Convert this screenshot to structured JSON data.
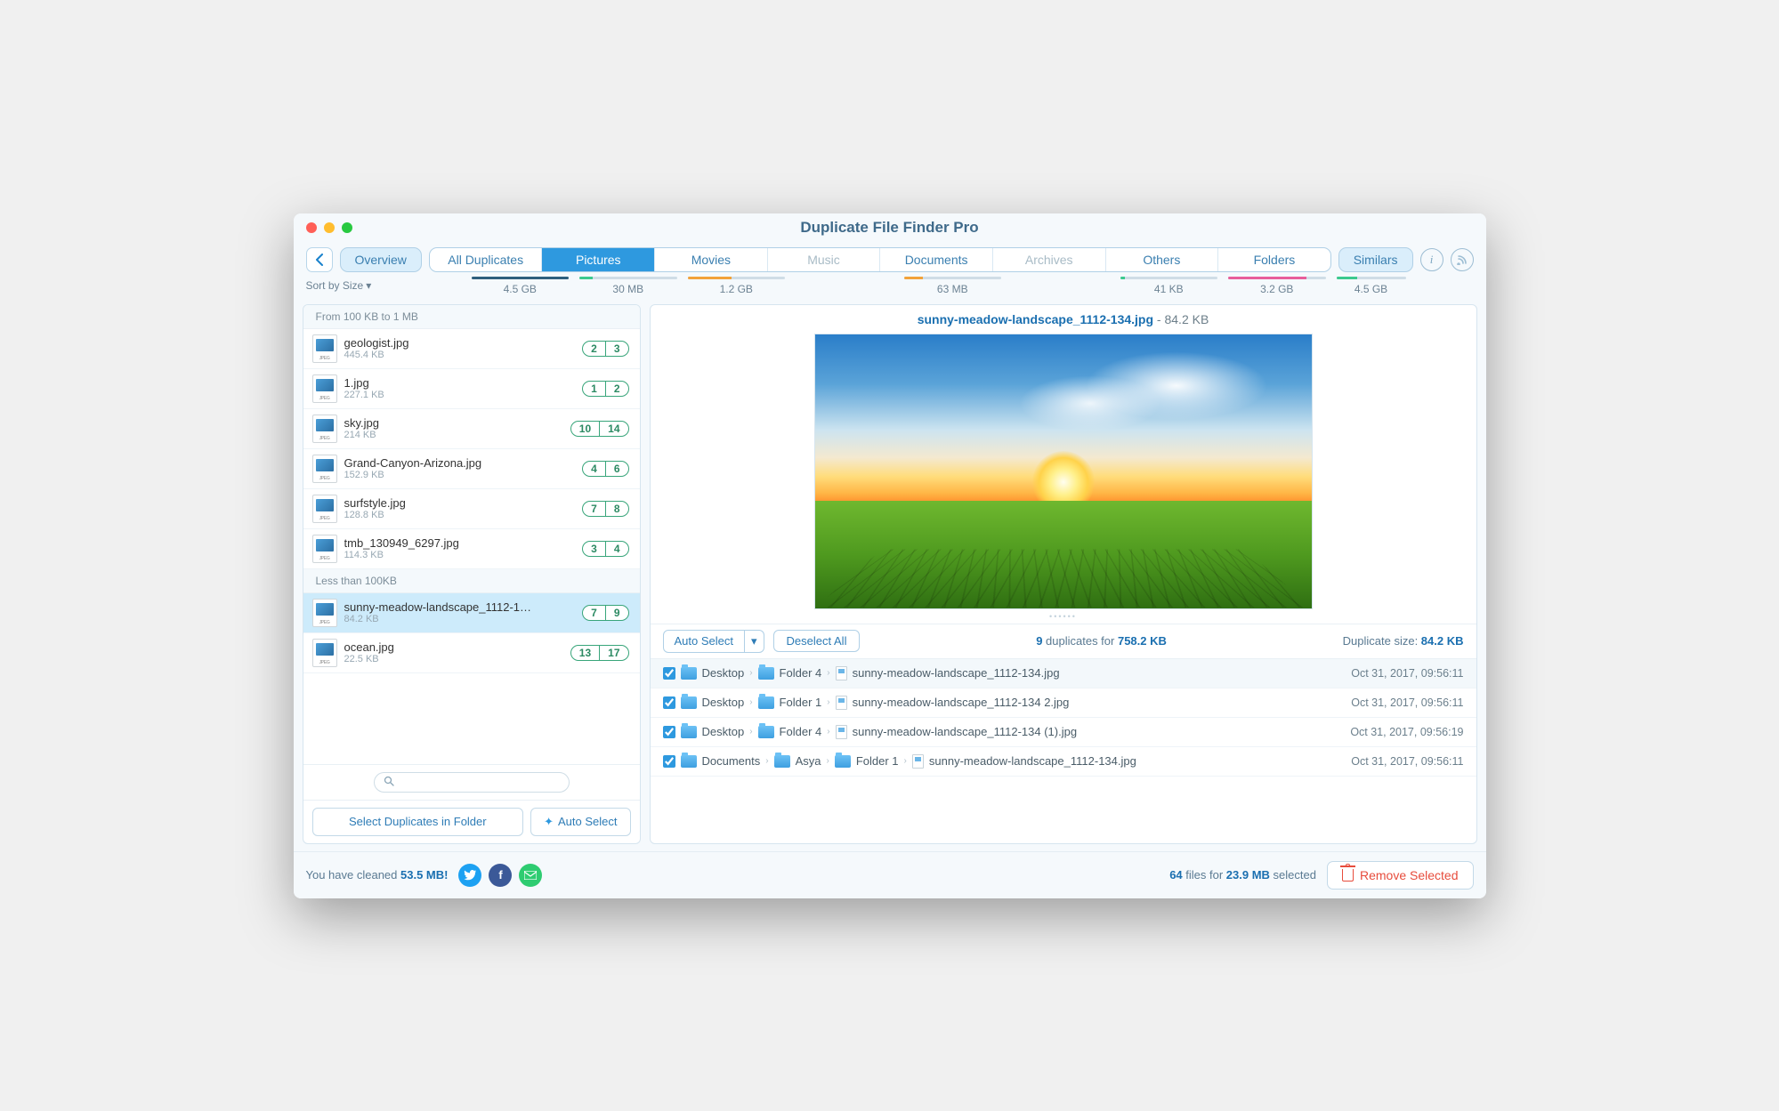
{
  "title": "Duplicate File Finder Pro",
  "sort_label": "Sort by Size",
  "tabs": [
    {
      "label": "Overview",
      "active": false,
      "disabled": false
    },
    {
      "label": "All Duplicates",
      "size": "4.5 GB",
      "bar_color": "#2f5f7d",
      "bar_pct": 100
    },
    {
      "label": "Pictures",
      "size": "30 MB",
      "bar_color": "#3cc98e",
      "bar_pct": 14,
      "active": true
    },
    {
      "label": "Movies",
      "size": "1.2 GB",
      "bar_color": "#f2a23a",
      "bar_pct": 45
    },
    {
      "label": "Music",
      "size": "",
      "disabled": true
    },
    {
      "label": "Documents",
      "size": "63 MB",
      "bar_color": "#f2a23a",
      "bar_pct": 20
    },
    {
      "label": "Archives",
      "size": "",
      "disabled": true
    },
    {
      "label": "Others",
      "size": "41 KB",
      "bar_color": "#3cc98e",
      "bar_pct": 5
    },
    {
      "label": "Folders",
      "size": "3.2 GB",
      "bar_color": "#e85e9a",
      "bar_pct": 80
    }
  ],
  "similars": {
    "label": "Similars",
    "size": "4.5 GB",
    "bar_pct": 30
  },
  "groups": [
    {
      "header": "From 100 KB to 1 MB",
      "files": [
        {
          "name": "geologist.jpg",
          "size": "445.4 KB",
          "c1": "2",
          "c2": "3"
        },
        {
          "name": "1.jpg",
          "size": "227.1 KB",
          "c1": "1",
          "c2": "2"
        },
        {
          "name": "sky.jpg",
          "size": "214 KB",
          "c1": "10",
          "c2": "14"
        },
        {
          "name": "Grand-Canyon-Arizona.jpg",
          "size": "152.9 KB",
          "c1": "4",
          "c2": "6"
        },
        {
          "name": "surfstyle.jpg",
          "size": "128.8 KB",
          "c1": "7",
          "c2": "8"
        },
        {
          "name": "tmb_130949_6297.jpg",
          "size": "114.3 KB",
          "c1": "3",
          "c2": "4"
        }
      ]
    },
    {
      "header": "Less than 100KB",
      "files": [
        {
          "name": "sunny-meadow-landscape_1112-1…",
          "size": "84.2 KB",
          "c1": "7",
          "c2": "9",
          "selected": true
        },
        {
          "name": "ocean.jpg",
          "size": "22.5 KB",
          "c1": "13",
          "c2": "17"
        }
      ]
    }
  ],
  "left_buttons": {
    "select_in_folder": "Select Duplicates in Folder",
    "auto_select": "Auto Select"
  },
  "preview": {
    "name": "sunny-meadow-landscape_1112-134.jpg",
    "size": "84.2 KB"
  },
  "dup_toolbar": {
    "auto_select": "Auto Select",
    "deselect_all": "Deselect All",
    "summary_count": "9",
    "summary_word": " duplicates for ",
    "summary_size": "758.2 KB",
    "dsize_label": "Duplicate size: ",
    "dsize_value": "84.2 KB"
  },
  "duplicates": [
    {
      "checked": true,
      "hl": true,
      "path": [
        "Desktop",
        "Folder 4"
      ],
      "file": "sunny-meadow-landscape_1112-134.jpg",
      "date": "Oct 31, 2017, 09:56:11"
    },
    {
      "checked": true,
      "path": [
        "Desktop",
        "Folder 1"
      ],
      "file": "sunny-meadow-landscape_1112-134 2.jpg",
      "date": "Oct 31, 2017, 09:56:11"
    },
    {
      "checked": true,
      "path": [
        "Desktop",
        "Folder 4"
      ],
      "file": "sunny-meadow-landscape_1112-134 (1).jpg",
      "date": "Oct 31, 2017, 09:56:19"
    },
    {
      "checked": true,
      "path": [
        "Documents",
        "Asya",
        "Folder 1"
      ],
      "file": "sunny-meadow-landscape_1112-134.jpg",
      "date": "Oct 31, 2017, 09:56:11"
    }
  ],
  "footer": {
    "cleaned_pre": "You have cleaned ",
    "cleaned_val": "53.5 MB!",
    "selected_count": "64",
    "selected_mid": " files for ",
    "selected_size": "23.9 MB",
    "selected_post": " selected",
    "remove": "Remove Selected"
  }
}
